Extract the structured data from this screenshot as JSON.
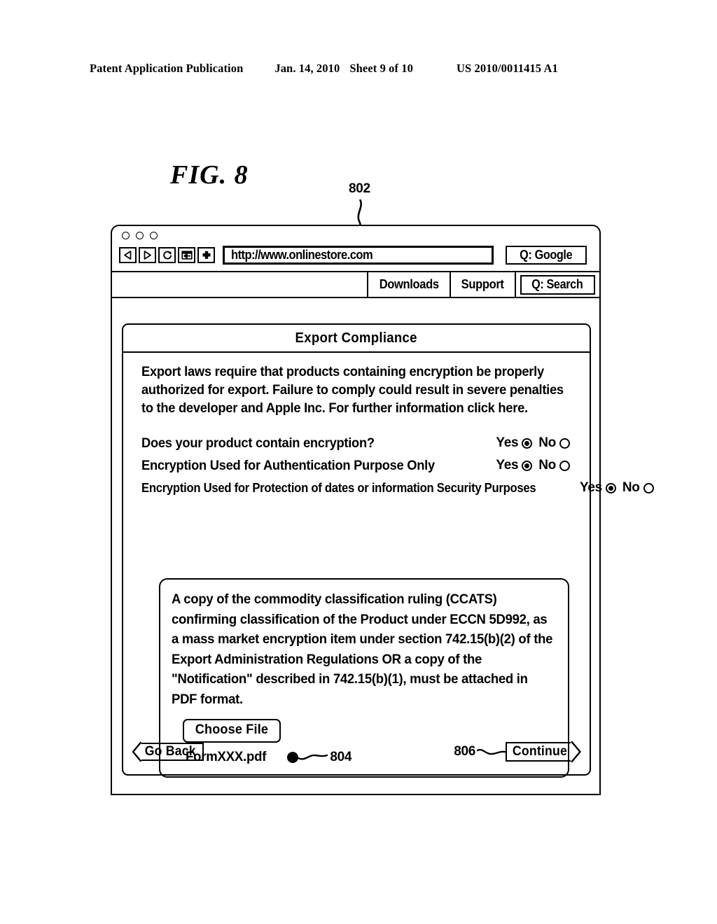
{
  "patent_header": {
    "publication": "Patent Application Publication",
    "date": "Jan. 14, 2010",
    "sheet": "Sheet 9 of 10",
    "number": "US 2010/0011415 A1"
  },
  "figure": {
    "caption": "FIG. 8",
    "callout_window": "802",
    "callout_file": "804",
    "callout_continue": "806"
  },
  "browser": {
    "window_dots": [
      "dot-1",
      "dot-2",
      "dot-3"
    ],
    "nav_buttons": [
      {
        "name": "back-button",
        "icon": "triangle-left-icon"
      },
      {
        "name": "forward-button",
        "icon": "triangle-right-icon"
      },
      {
        "name": "reload-button",
        "icon": "reload-circular-arrow-icon"
      },
      {
        "name": "bookmark-button",
        "icon": "add-bookmark-icon"
      },
      {
        "name": "new-tab-button",
        "icon": "plus-icon"
      }
    ],
    "url": "http://www.onlinestore.com",
    "google_search": "Q: Google",
    "bookmarks": [
      "Downloads",
      "Support"
    ],
    "site_search": "Q: Search"
  },
  "dialog": {
    "title": "Export Compliance",
    "intro": "Export laws require that products containing encryption be properly authorized for export. Failure to comply could result in severe penalties to the developer and Apple Inc. For further information click here.",
    "questions": [
      {
        "label": "Does your product contain encryption?",
        "yes_label": "Yes",
        "no_label": "No",
        "selected": "Yes"
      },
      {
        "label": "Encryption Used for Authentication Purpose Only",
        "yes_label": "Yes",
        "no_label": "No",
        "selected": "Yes"
      },
      {
        "label": "Encryption Used for Protection of dates or information Security Purposes",
        "yes_label": "Yes",
        "no_label": "No",
        "selected": "Yes"
      }
    ],
    "attachment": {
      "instructions": "A copy of the commodity classification ruling (CCATS) confirming classification of the Product under ECCN 5D992, as a mass market encryption item under section 742.15(b)(2) of the Export Administration Regulations OR a copy of the \"Notification\" described in 742.15(b)(1), must be attached in PDF format.",
      "choose_file_label": "Choose File",
      "file_name": "FormXXX.pdf"
    },
    "footer": {
      "go_back_label": "Go Back",
      "continue_label": "Continue"
    }
  }
}
